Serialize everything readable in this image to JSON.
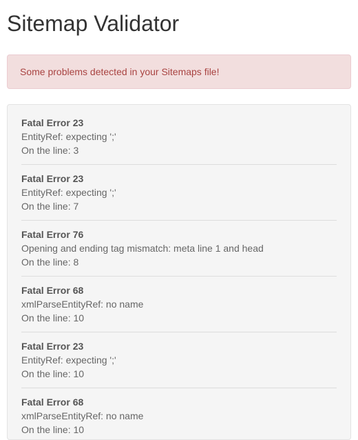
{
  "title": "Sitemap Validator",
  "alert": "Some problems detected in your Sitemaps file!",
  "errors": [
    {
      "header": "Fatal Error 23",
      "message": "EntityRef: expecting ';'",
      "line": "On the line: 3"
    },
    {
      "header": "Fatal Error 23",
      "message": "EntityRef: expecting ';'",
      "line": "On the line: 7"
    },
    {
      "header": "Fatal Error 76",
      "message": "Opening and ending tag mismatch: meta line 1 and head",
      "line": "On the line: 8"
    },
    {
      "header": "Fatal Error 68",
      "message": "xmlParseEntityRef: no name",
      "line": "On the line: 10"
    },
    {
      "header": "Fatal Error 23",
      "message": "EntityRef: expecting ';'",
      "line": "On the line: 10"
    },
    {
      "header": "Fatal Error 68",
      "message": "xmlParseEntityRef: no name",
      "line": "On the line: 10"
    }
  ]
}
